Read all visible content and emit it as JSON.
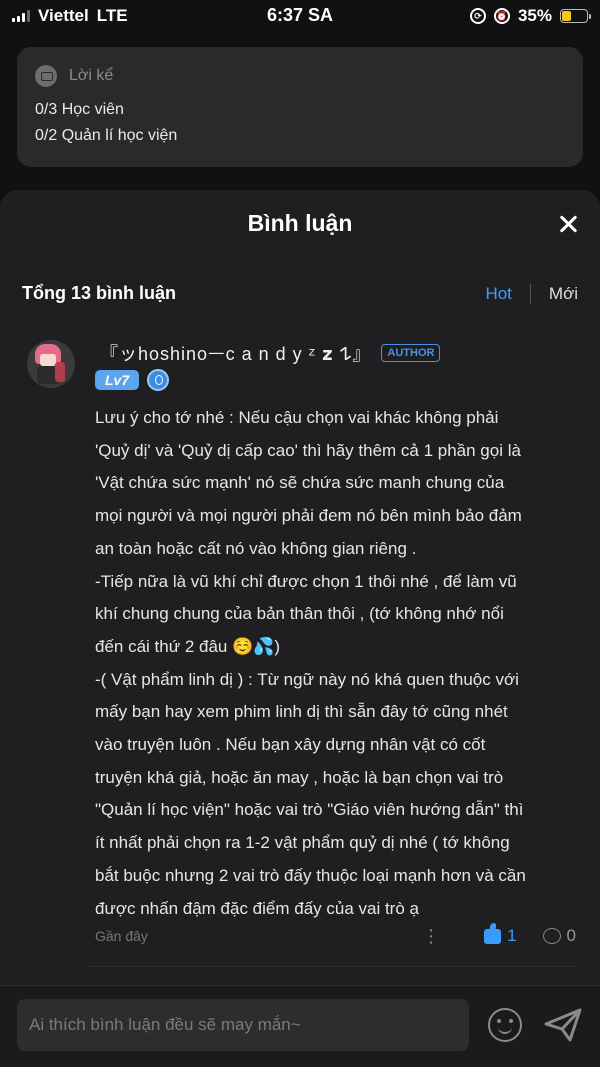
{
  "status_bar": {
    "carrier": "Viettel",
    "network": "LTE",
    "time": "6:37 SA",
    "battery_percent": "35%",
    "battery_level": 0.35
  },
  "info_card": {
    "title": "Lời kể",
    "lines": [
      "0/3 Học viên",
      "0/2 Quản lí học viện"
    ]
  },
  "sheet": {
    "title": "Bình luận",
    "count_label": "Tổng 13 bình luận",
    "sort_hot": "Hot",
    "sort_new": "Mới"
  },
  "comment": {
    "username": "『ッhoshinoᅳc a n d y ᶻ 𝘇 𐰁』",
    "author_badge": "AUTHOR",
    "level": "Lv7",
    "lines": [
      "Lưu ý cho tớ nhé : Nếu cậu chọn vai khác không phải",
      "'Quỷ dị' và 'Quỷ dị cấp cao' thì hãy thêm cả 1 phần gọi là",
      "'Vật chứa sức mạnh' nó sẽ chứa sức manh chung của",
      "mọi người và mọi người phải đem nó bên mình bảo đảm",
      "an toàn hoặc cất nó vào không gian riêng .",
      "-Tiếp nữa là vũ khí chỉ được chọn 1 thôi nhé , để làm vũ",
      "khí chung chung của bản thân thôi , (tớ không nhớ nổi",
      "đến cái thứ 2 đâu ☺️💦)",
      "-( Vật phẩm linh dị ) : Từ ngữ này nó khá quen thuộc với",
      "mấy bạn hay xem phim linh dị thì sẵn đây tớ cũng nhét",
      "vào truyện luôn . Nếu bạn xây dựng nhân vật có cốt",
      "truyện khá giả, hoặc ăn may , hoặc là bạn chọn vai trò",
      "\"Quản lí học viện\" hoặc vai trò \"Giáo viên hướng dẫn\" thì",
      "ít nhất phải chọn ra 1-2 vật phẩm quỷ dị nhé ( tớ không",
      "bắt buộc nhưng 2 vai trò đấy thuộc loại mạnh hơn và cần",
      "được nhấn đậm đặc điểm đấy của vai trò ạ"
    ],
    "time_ago": "Gần đây",
    "likes": "1",
    "replies": "0"
  },
  "composer": {
    "placeholder": "Ai thích bình luận đều sẽ may mắn~"
  },
  "colors": {
    "accent": "#3aa0ff",
    "background": "#1f1f21",
    "battery": "#f5c518"
  }
}
